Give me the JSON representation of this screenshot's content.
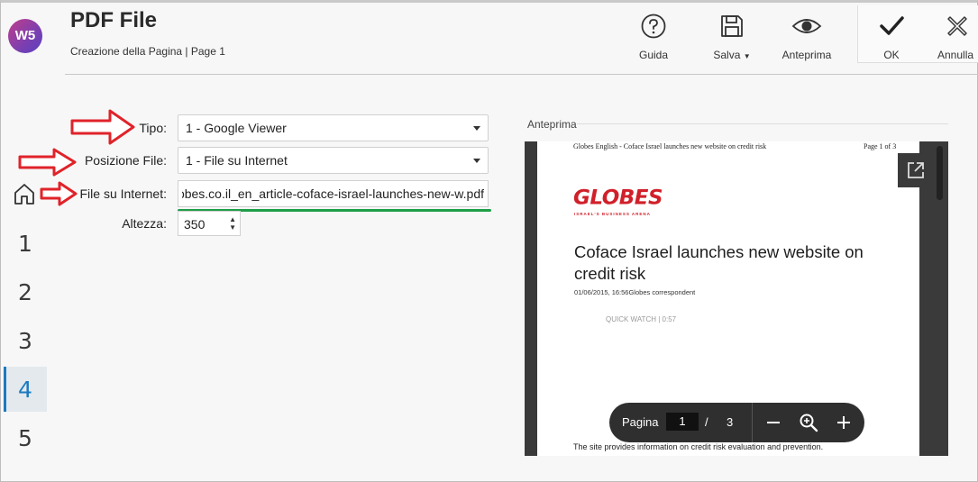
{
  "app": {
    "logo_text": "W5"
  },
  "header": {
    "title": "PDF File",
    "subtitle": "Creazione della Pagina | Page 1"
  },
  "toolbar": {
    "guida": "Guida",
    "salva": "Salva",
    "anteprima": "Anteprima",
    "ok": "OK",
    "annulla": "Annulla"
  },
  "steps": [
    "1",
    "2",
    "3",
    "4",
    "5"
  ],
  "active_step": "4",
  "form": {
    "tipo_label": "Tipo:",
    "tipo_value": "1 - Google Viewer",
    "posizione_label": "Posizione File:",
    "posizione_value": "1 - File su Internet",
    "file_label": "File su Internet:",
    "file_value": "www.globes.co.il_en_article-coface-israel-launches-new-w.pdf",
    "altezza_label": "Altezza:",
    "altezza_value": "350"
  },
  "preview": {
    "label": "Anteprima",
    "doc_header_left": "Globes English - Coface Israel launches new website on credit risk",
    "doc_header_right": "Page 1 of 3",
    "logo": "GLOBES",
    "logo_sub": "ISRAEL'S BUSINESS ARENA",
    "headline": "Coface Israel launches new website on credit risk",
    "byline": "01/06/2015, 16:56Globes correspondent",
    "quick_watch": "QUICK WATCH | 0:57",
    "bottom_text": "The site provides information on credit risk evaluation and prevention.",
    "pager_label": "Pagina",
    "current_page": "1",
    "separator": "/",
    "total_pages": "3"
  }
}
